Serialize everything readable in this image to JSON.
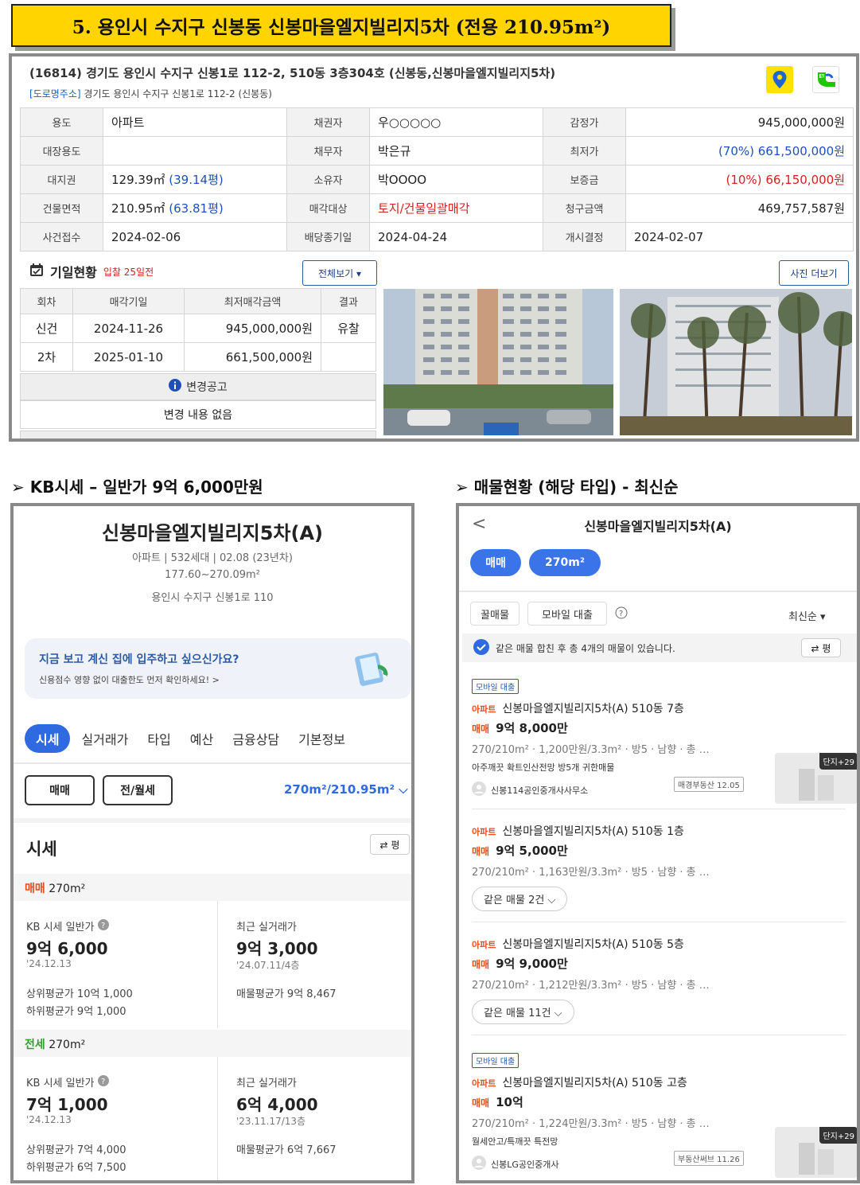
{
  "title": "5. 용인시 수지구 신봉동 신봉마을엘지빌리지5차 (전용 210.95m²)",
  "address": {
    "jibun": "(16814) 경기도 용인시 수지구 신봉1로 112-2, 510동 3층304호 (신봉동,신봉마을엘지빌리지5차)",
    "road_tag": "[도로명주소]",
    "road": "경기도 용인시 수지구 신봉1로 112-2 (신봉동)"
  },
  "map_icons": [
    "kakao-map-icon",
    "naver-map-icon"
  ],
  "info": [
    [
      "용도",
      "아파트",
      "채권자",
      "우○○○○○",
      "감정가",
      "945,000,000원"
    ],
    [
      "대장용도",
      "",
      "채무자",
      "박은규",
      "최저가",
      "(70%) 661,500,000원"
    ],
    [
      "대지권",
      "129.39㎡ (39.14평)",
      "소유자",
      "박OOOO",
      "보증금",
      "(10%) 66,150,000원"
    ],
    [
      "건물면적",
      "210.95㎡ (63.81평)",
      "매각대상",
      "토지/건물일괄매각",
      "청구금액",
      "469,757,587원"
    ],
    [
      "사건접수",
      "2024-02-06",
      "배당종기일",
      "2024-04-24",
      "개시결정",
      "2024-02-07"
    ]
  ],
  "info_parts": {
    "land_area": "129.39㎡",
    "land_pyeong": "(39.14평)",
    "bldg_area": "210.95㎡",
    "bldg_pyeong": "(63.81평)",
    "min_pct": "(70%)",
    "min_val": "661,500,000원",
    "dep_pct": "(10%)",
    "dep_val": "66,150,000원"
  },
  "schedule": {
    "title": "기일현황",
    "dday": "입찰 25일전",
    "all_button": "전체보기 ▾",
    "photo_button": "사진 더보기",
    "headers": [
      "회차",
      "매각기일",
      "최저매각금액",
      "결과"
    ],
    "rows": [
      [
        "신건",
        "2024-11-26",
        "945,000,000원",
        "유찰"
      ],
      [
        "2차",
        "2025-01-10",
        "661,500,000원",
        ""
      ]
    ],
    "change_title": "변경공고",
    "change_value": "변경 내용 없음"
  },
  "section_kb": "➢ KB시세 – 일반가 9억 6,000만원",
  "section_listing": "➢ 매물현황 (해당 타입) - 최신순",
  "kb": {
    "name": "신봉마을엘지빌리지5차(A)",
    "meta1": "아파트 | 532세대 | 02.08 (23년차)",
    "meta2": "177.60~270.09m²",
    "meta3": "용인시 수지구 신봉1로 110",
    "banner_title": "지금 보고 계신 집에 입주하고 싶으신가요?",
    "banner_sub": "신용점수 영향 없이 대출한도 먼저 확인하세요! >",
    "tabs": [
      "시세",
      "실거래가",
      "타입",
      "예산",
      "금융상담",
      "기본정보"
    ],
    "btn_sale": "매매",
    "btn_rent": "전/월세",
    "area": "270m²/210.95m²  ⌵",
    "sise_title": "시세",
    "toggle": "⇄ 평",
    "sale": {
      "label": "매매",
      "size": "270m²",
      "kb_label": "KB 시세 일반가",
      "kb_price": "9억 6,000",
      "kb_date": "'24.12.13",
      "upper": "상위평균가 10억 1,000",
      "lower": "하위평균가 9억 1,000",
      "recent_label": "최근 실거래가",
      "recent_price": "9억 3,000",
      "recent_date": "'24.07.11/4층",
      "avg": "매물평균가 9억 8,467"
    },
    "jeonse": {
      "label": "전세",
      "size": "270m²",
      "kb_label": "KB 시세 일반가",
      "kb_price": "7억 1,000",
      "kb_date": "'24.12.13",
      "upper": "상위평균가 7억 4,000",
      "lower": "하위평균가 6억 7,500",
      "recent_label": "최근 실거래가",
      "recent_price": "6억 4,000",
      "recent_date": "'23.11.17/13층",
      "avg": "매물평균가 6억 7,667"
    }
  },
  "listing": {
    "back": "<",
    "name": "신봉마을엘지빌리지5차(A)",
    "pill1": "매매",
    "pill2": "270m²",
    "chip1": "꿀매물",
    "chip2": "모바일 대출",
    "sort": "최신순 ▾",
    "notice": "같은 매물 합친 후 총 4개의 매물이 있습니다.",
    "toggle": "⇄ 평",
    "items": [
      {
        "badge": "모바일 대출",
        "type": "아파트",
        "title": "신봉마을엘지빌리지5차(A) 510동 7층",
        "deal": "매매",
        "price": "9억 8,000만",
        "desc": "270/210m² · 1,200만원/3.3m² · 방5 · 남향 · 총 …",
        "note": "아주깨끗 확트인산전망 방5개 귀한매물",
        "agent": "신봉114공인중개사사무소",
        "src": "매경부동산 12.05",
        "thumb": "단지+29"
      },
      {
        "type": "아파트",
        "title": "신봉마을엘지빌리지5차(A) 510동 1층",
        "deal": "매매",
        "price": "9억 5,000만",
        "desc": "270/210m² · 1,163만원/3.3m² · 방5 · 남향 · 총 …",
        "same": "같은 매물 2건 ⌵"
      },
      {
        "type": "아파트",
        "title": "신봉마을엘지빌리지5차(A) 510동 5층",
        "deal": "매매",
        "price": "9억 9,000만",
        "desc": "270/210m² · 1,212만원/3.3m² · 방5 · 남향 · 총 …",
        "same": "같은 매물 11건 ⌵"
      },
      {
        "badge": "모바일 대출",
        "type": "아파트",
        "title": "신봉마을엘지빌리지5차(A) 510동 고층",
        "deal": "매매",
        "price": "10억",
        "desc": "270/210m² · 1,224만원/3.3m² · 방5 · 남향 · 총 …",
        "note": "월세안고/특깨끗 특전망",
        "agent": "신봉LG공인중개사",
        "src": "부동산써브 11.26",
        "thumb": "단지+29"
      }
    ]
  },
  "colors": {
    "title_bg": "#ffd400",
    "accent_blue": "#2f6ae0",
    "accent_orange": "#e44f1d",
    "red": "#d42020"
  }
}
